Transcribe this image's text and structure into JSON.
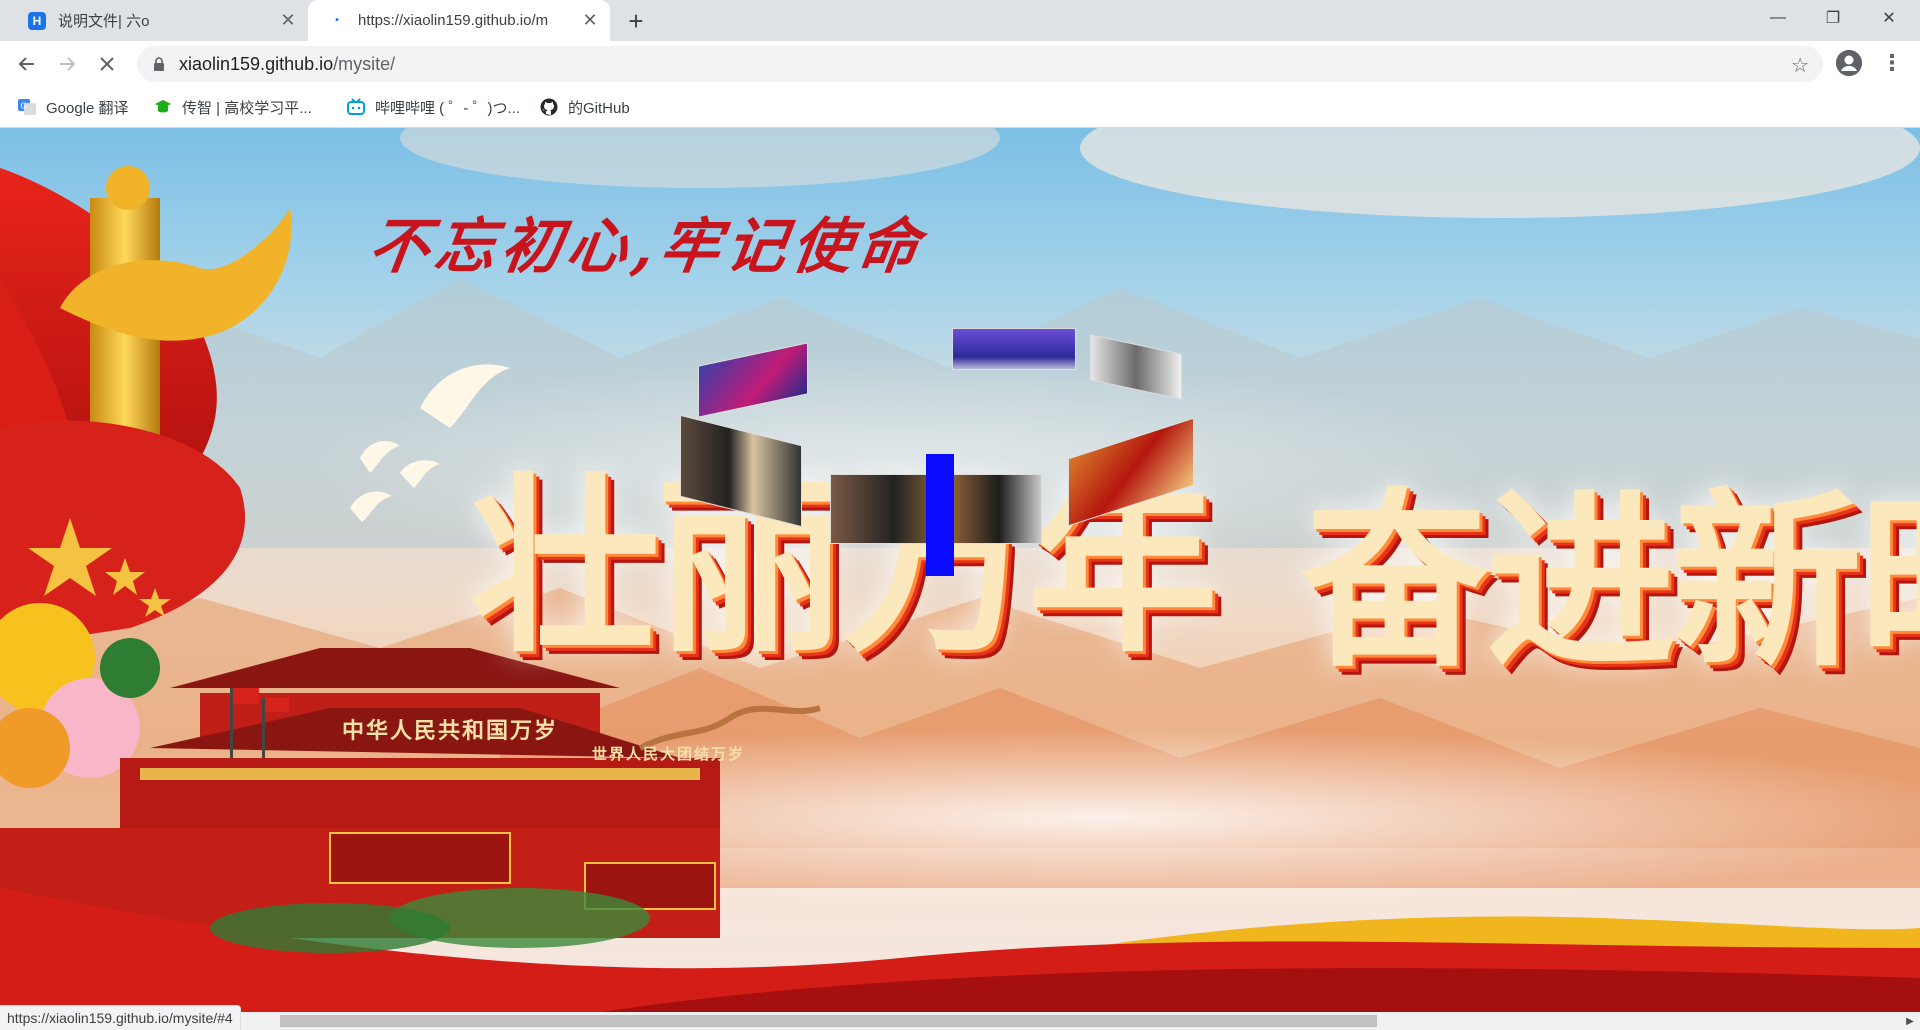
{
  "browser": {
    "tabs": [
      {
        "title": "说明文件| 六o",
        "active": false,
        "favicon": "h-logo-icon"
      },
      {
        "title": "https://xiaolin159.github.io/m",
        "active": true,
        "favicon": "loading-dot-icon"
      }
    ],
    "new_tab_label": "+",
    "window_controls": {
      "minimize": "—",
      "restore": "❐",
      "close": "✕"
    },
    "address": {
      "host": "xiaolin159.github.io",
      "path": "/mysite/"
    },
    "bookmarks": [
      {
        "label": "Google 翻译",
        "icon": "google-translate-icon"
      },
      {
        "label": "传智 | 高校学习平...",
        "icon": "chuanzhi-icon"
      },
      {
        "label": "哔哩哔哩 ( ゜- ゜)つ...",
        "icon": "bilibili-icon"
      },
      {
        "label": "的GitHub",
        "icon": "github-icon"
      }
    ],
    "status_url": "https://xiaolin159.github.io/mysite/#4"
  },
  "page": {
    "slogan": "不忘初心,牢记使命",
    "gate_sign_left": "中华人民共和国万岁",
    "gate_sign_right": "世界人民大团结万岁",
    "colors": {
      "primary_red": "#c8141c",
      "gold": "#f5c242",
      "title_cream": "#fbe8bd"
    }
  }
}
